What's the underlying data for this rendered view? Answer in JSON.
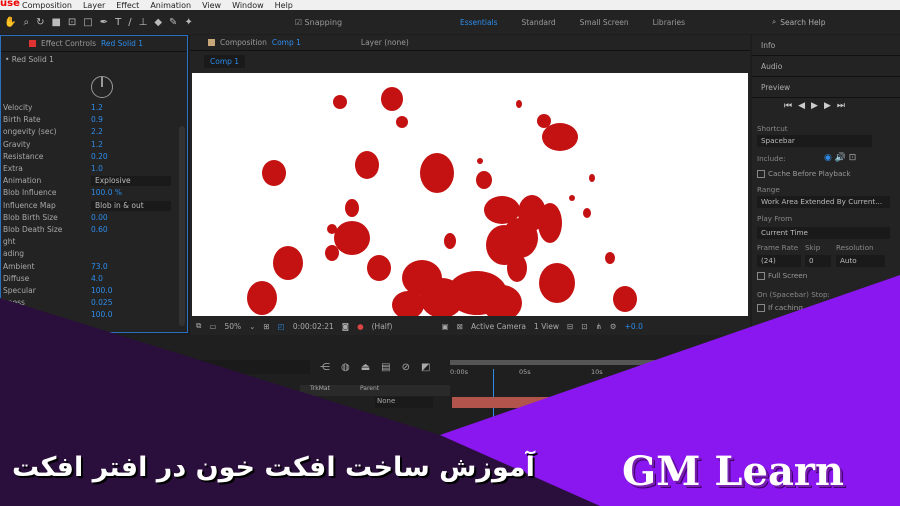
{
  "menu": {
    "logo": "use",
    "items": [
      "Composition",
      "Layer",
      "Effect",
      "Animation",
      "View",
      "Window",
      "Help"
    ]
  },
  "toolbar": {
    "snapping": "Snapping"
  },
  "workspaces": {
    "items": [
      "Essentials",
      "Standard",
      "Small Screen",
      "Libraries"
    ],
    "active": "Essentials",
    "search_placeholder": "Search Help"
  },
  "effect_controls": {
    "tab": "Effect Controls",
    "layer": "Red Solid 1",
    "breadcrumb": "• Red Solid 1",
    "props": [
      {
        "name": "Velocity",
        "value": "1.2"
      },
      {
        "name": "Birth Rate",
        "value": "0.9"
      },
      {
        "name": "ongevity (sec)",
        "value": "2.2"
      },
      {
        "name": "Gravity",
        "value": "1.2"
      },
      {
        "name": "Resistance",
        "value": "0.20"
      },
      {
        "name": "Extra",
        "value": "1.0"
      },
      {
        "name": "Animation",
        "value": "Explosive",
        "dropdown": true
      },
      {
        "name": "Blob Influence",
        "value": "100.0 %"
      },
      {
        "name": "Influence Map",
        "value": "Blob in & out",
        "dropdown": true
      },
      {
        "name": "Blob Birth Size",
        "value": "0.00"
      },
      {
        "name": "Blob Death Size",
        "value": "0.60"
      },
      {
        "name": "ght",
        "value": ""
      },
      {
        "name": "ading",
        "value": ""
      },
      {
        "name": "Ambient",
        "value": "73.0"
      },
      {
        "name": "Diffuse",
        "value": "4.0"
      },
      {
        "name": "Specular",
        "value": "100.0"
      },
      {
        "name": "hness",
        "value": "0.025"
      },
      {
        "name": "",
        "value": "100.0"
      }
    ]
  },
  "composition": {
    "tab": "Composition",
    "name": "Comp 1",
    "layer_tab": "Layer (none)",
    "sub_tab": "Comp 1",
    "viewer_bar": {
      "zoom": "50%",
      "timecode": "0:00:02:21",
      "resolution": "(Half)",
      "camera": "Active Camera",
      "views": "1 View",
      "exposure": "+0.0"
    }
  },
  "right_panel": {
    "info": "Info",
    "audio": "Audio",
    "preview": "Preview",
    "shortcut_label": "Shortcut",
    "shortcut": "Spacebar",
    "include": "Include:",
    "cache": "Cache Before Playback",
    "range_label": "Range",
    "range": "Work Area Extended By Current...",
    "play_from_label": "Play From",
    "play_from": "Current Time",
    "frame_rate_label": "Frame Rate",
    "skip_label": "Skip",
    "resolution_label": "Resolution",
    "frame_rate": "(24)",
    "skip": "0",
    "resolution": "Auto",
    "full_screen": "Full Screen",
    "stop_label": "On (Spacebar) Stop:",
    "if_caching": "If caching..."
  },
  "timeline": {
    "ticks": [
      "0:00s",
      "05s",
      "10s"
    ],
    "col_trkmat": "TrkMat",
    "col_parent": "Parent",
    "parent_value": "None"
  },
  "banner": {
    "title": "آموزش ساخت افکت خون در افتر افکت",
    "brand": "GM Learn",
    "dark_purple": "#2a0e3c",
    "bright_purple": "#8a16f0"
  }
}
